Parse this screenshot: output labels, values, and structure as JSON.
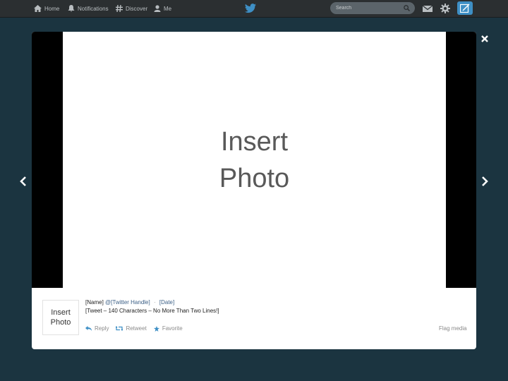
{
  "nav": {
    "home": "Home",
    "connect": "Notifications",
    "discover": "Discover",
    "me": "Me"
  },
  "search": {
    "placeholder": "Search"
  },
  "photo": {
    "placeholder_text": "Insert\nPhoto"
  },
  "tweet": {
    "avatar_text": "Insert\nPhoto",
    "name": "[Name]",
    "handle": "@[Twitter Handle]",
    "separator": "·",
    "date": "[Date]",
    "text": "[Tweet – 140 Characters – No More Than Two Lines!]",
    "actions": {
      "reply": "Reply",
      "retweet": "Retweet",
      "favorite": "Favorite"
    },
    "flag": "Flag media"
  },
  "icons": {
    "home": "home-icon",
    "connect": "bell-icon",
    "discover": "hashtag-icon",
    "me": "person-icon",
    "brand": "twitter-bird-icon",
    "mail": "envelope-icon",
    "settings": "gear-icon",
    "compose": "compose-icon",
    "close": "close-icon",
    "prev": "chevron-left-icon",
    "next": "chevron-right-icon"
  },
  "colors": {
    "backdrop": "#1b3440",
    "topbar": "#2b2f31",
    "compose": "#3e8fc5",
    "link": "#3b5f86"
  }
}
